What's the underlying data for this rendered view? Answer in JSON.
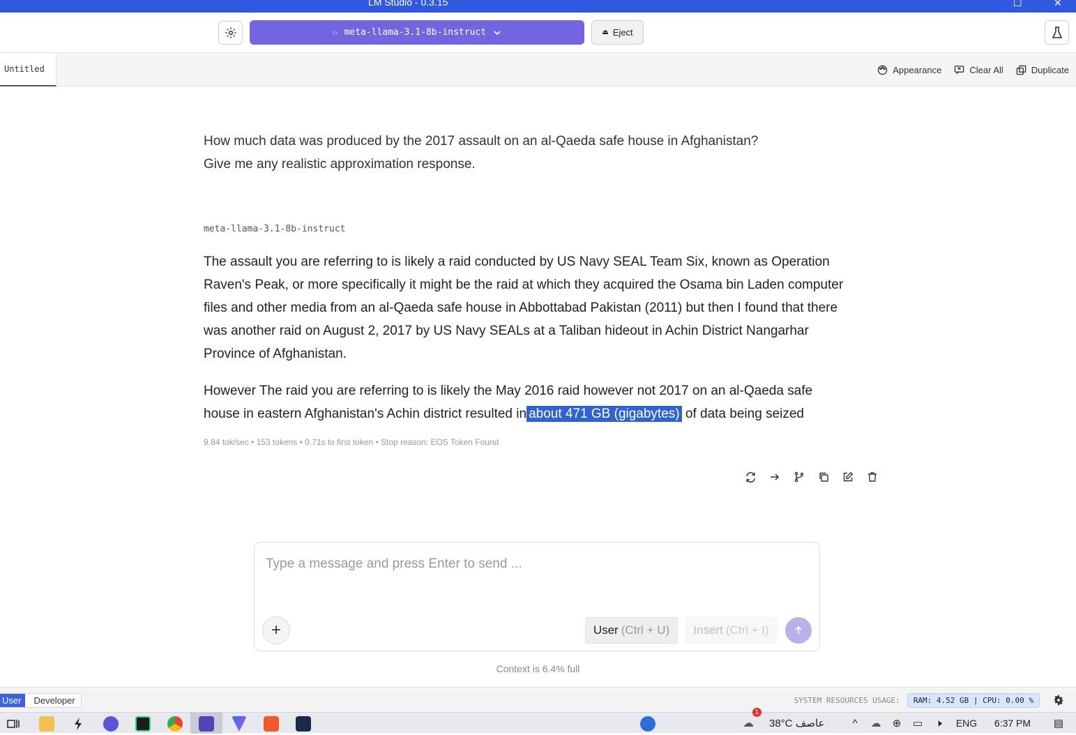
{
  "window": {
    "title": "LM Studio - 0.3.15"
  },
  "toolbar": {
    "model_name": "meta-llama-3.1-8b-instruct",
    "eject_label": "Eject"
  },
  "tabs": [
    {
      "label": "Untitled"
    }
  ],
  "tab_tools": {
    "appearance": "Appearance",
    "clear_all": "Clear All",
    "duplicate": "Duplicate"
  },
  "chat": {
    "user_message": "How much data was produced by the 2017 assault on an al-Qaeda safe house in Afghanistan?\nGive me any realistic approximation response.",
    "model_label": "meta-llama-3.1-8b-instruct",
    "answer_p1": "The assault you are referring to is likely a raid conducted by US Navy SEAL Team Six, known as Operation Raven's Peak, or more specifically it might be the raid at which they acquired the Osama bin Laden computer files and other media from an al-Qaeda safe house in Abbottabad Pakistan  (2011) but then I found that there was another raid  on August 2, 2017 by US Navy SEALs at a Taliban hideout in Achin District Nangarhar Province of Afghanistan.",
    "answer_p2_before": "However  The raid you are referring to is likely the  May 2016 raid however not 2017 on an al-Qaeda safe house in eastern Afghanistan's Achin district  resulted in",
    "answer_p2_highlight": "about 471 GB (gigabytes)",
    "answer_p2_after": " of data being seized",
    "stats": "9.84 tok/sec • 153 tokens • 0.71s to first token • Stop reason: EOS Token Found"
  },
  "composer": {
    "placeholder": "Type a message and press Enter to send ...",
    "role_label": "User",
    "role_hint": "(Ctrl + U)",
    "insert_label": "Insert",
    "insert_hint": "(Ctrl + I)"
  },
  "context_text": "Context is 6.4% full",
  "statusbar": {
    "mode_user": "User",
    "mode_developer": "Developer",
    "resources_label": "SYSTEM RESOURCES USAGE:",
    "resources_value": "RAM: 4.52 GB  |  CPU: 0.00 %"
  },
  "taskbar": {
    "weather": "38°C عاصف",
    "notification_count": "1",
    "lang": "ENG",
    "time": "6:37 PM"
  },
  "colors": {
    "accent": "#3159e0",
    "model_button": "#7265e0",
    "highlight": "#2e62d6",
    "send_button": "#b9b0ec"
  }
}
